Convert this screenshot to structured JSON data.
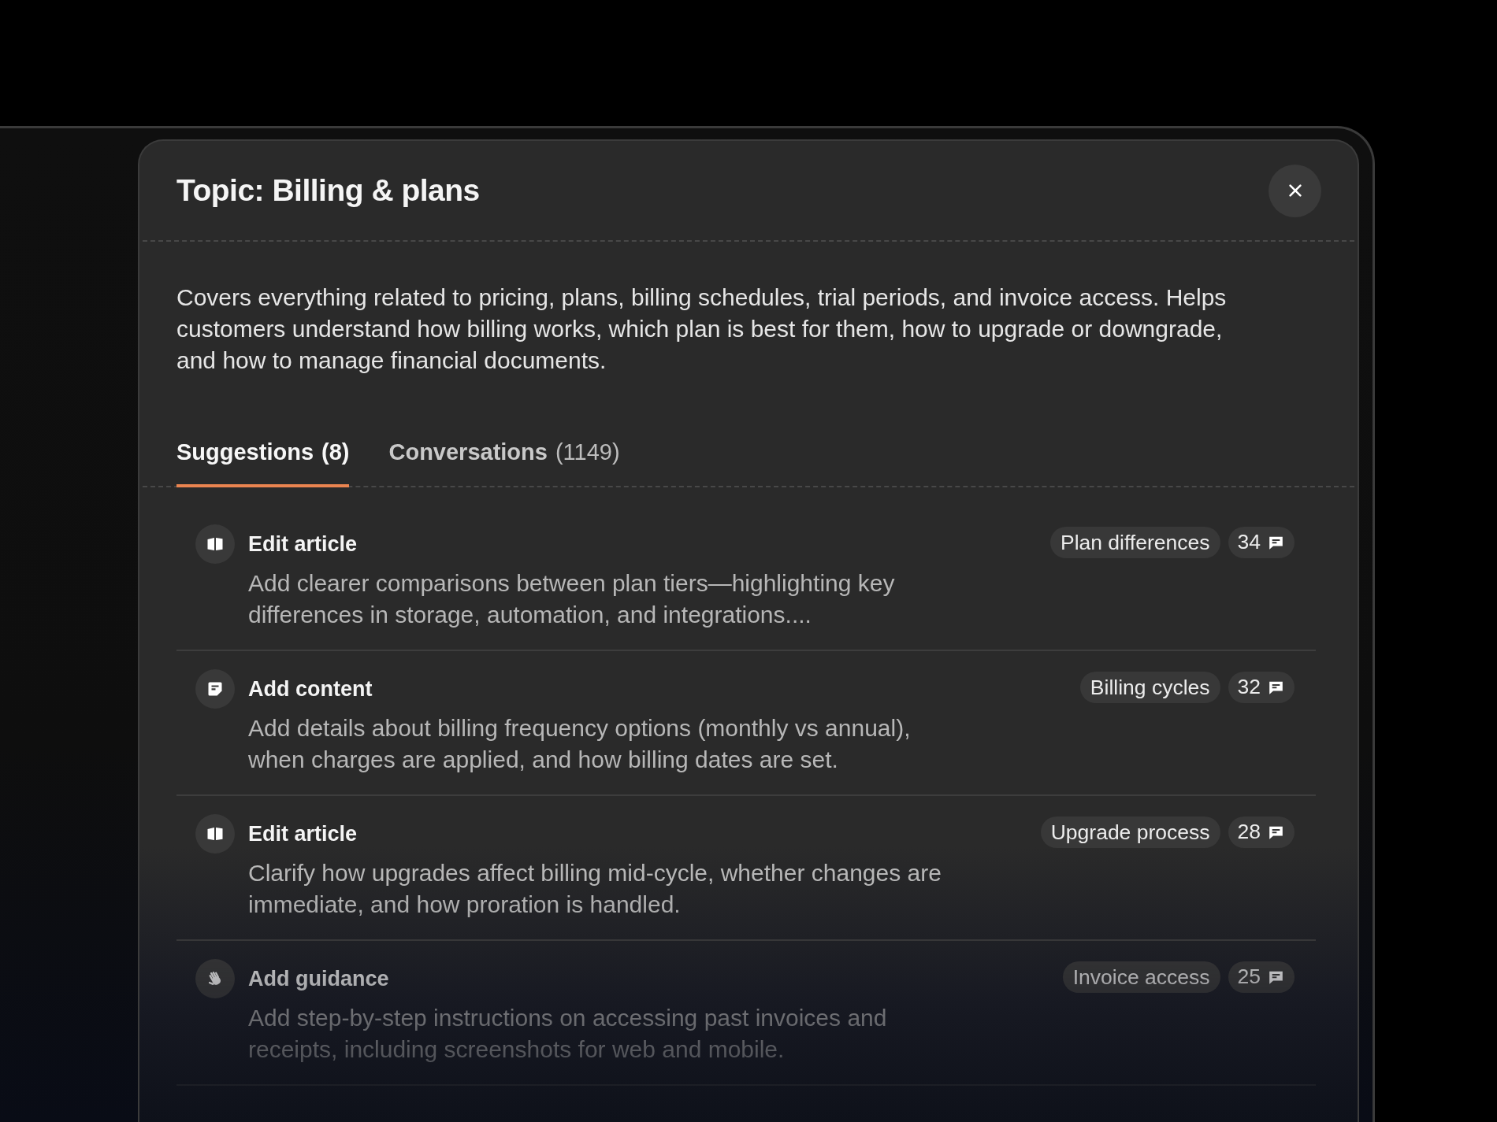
{
  "dialog": {
    "title": "Topic: Billing & plans",
    "description": "Covers everything related to pricing, plans, billing schedules, trial periods, and invoice access. Helps customers understand how billing works, which plan is best for them, how to upgrade or downgrade, and how to manage financial documents."
  },
  "tabs": [
    {
      "label": "Suggestions",
      "count": "(8)",
      "selected": true
    },
    {
      "label": "Conversations",
      "count": "(1149)",
      "selected": false
    }
  ],
  "suggestions": [
    {
      "kind": "edit_article",
      "title": "Edit article",
      "description": "Add clearer comparisons between plan tiers—highlighting key differences in storage, automation, and integrations....",
      "topic": "Plan differences",
      "count": "34"
    },
    {
      "kind": "add_content",
      "title": "Add content",
      "description": "Add details about billing frequency options (monthly vs annual), when charges are applied, and how billing dates are set.",
      "topic": "Billing cycles",
      "count": "32"
    },
    {
      "kind": "edit_article",
      "title": "Edit article",
      "description": "Clarify how upgrades affect billing mid-cycle, whether changes are immediate, and how proration is handled.",
      "topic": "Upgrade process",
      "count": "28"
    },
    {
      "kind": "add_guidance",
      "title": "Add guidance",
      "description": "Add step-by-step instructions on accessing past invoices and receipts, including screenshots for web and mobile.",
      "topic": "Invoice access",
      "count": "25"
    }
  ]
}
